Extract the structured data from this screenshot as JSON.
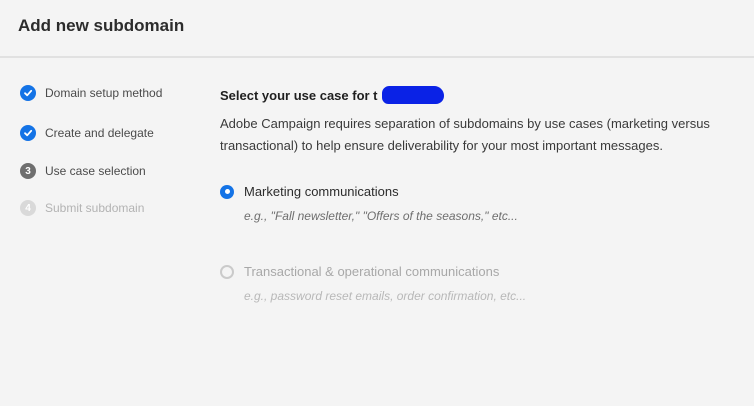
{
  "header": {
    "title": "Add new subdomain"
  },
  "steps": [
    {
      "label": "Domain setup method",
      "state": "done"
    },
    {
      "label": "Create and delegate",
      "state": "done"
    },
    {
      "label": "Use case selection",
      "state": "current",
      "number": "3"
    },
    {
      "label": "Submit subdomain",
      "state": "pending",
      "number": "4"
    }
  ],
  "main": {
    "heading": "Select your use case for t",
    "description": "Adobe Campaign requires separation of subdomains by use cases (marketing versus transactional) to help ensure deliverability for your most important messages.",
    "options": [
      {
        "label": "Marketing communications",
        "example": "e.g., \"Fall newsletter,\" \"Offers of the seasons,\" etc...",
        "selected": true,
        "enabled": true
      },
      {
        "label": "Transactional & operational communications",
        "example": "e.g., password reset emails, order confirmation, etc...",
        "selected": false,
        "enabled": false
      }
    ]
  },
  "colors": {
    "accent": "#1473e6",
    "redaction": "#0a22e6"
  }
}
